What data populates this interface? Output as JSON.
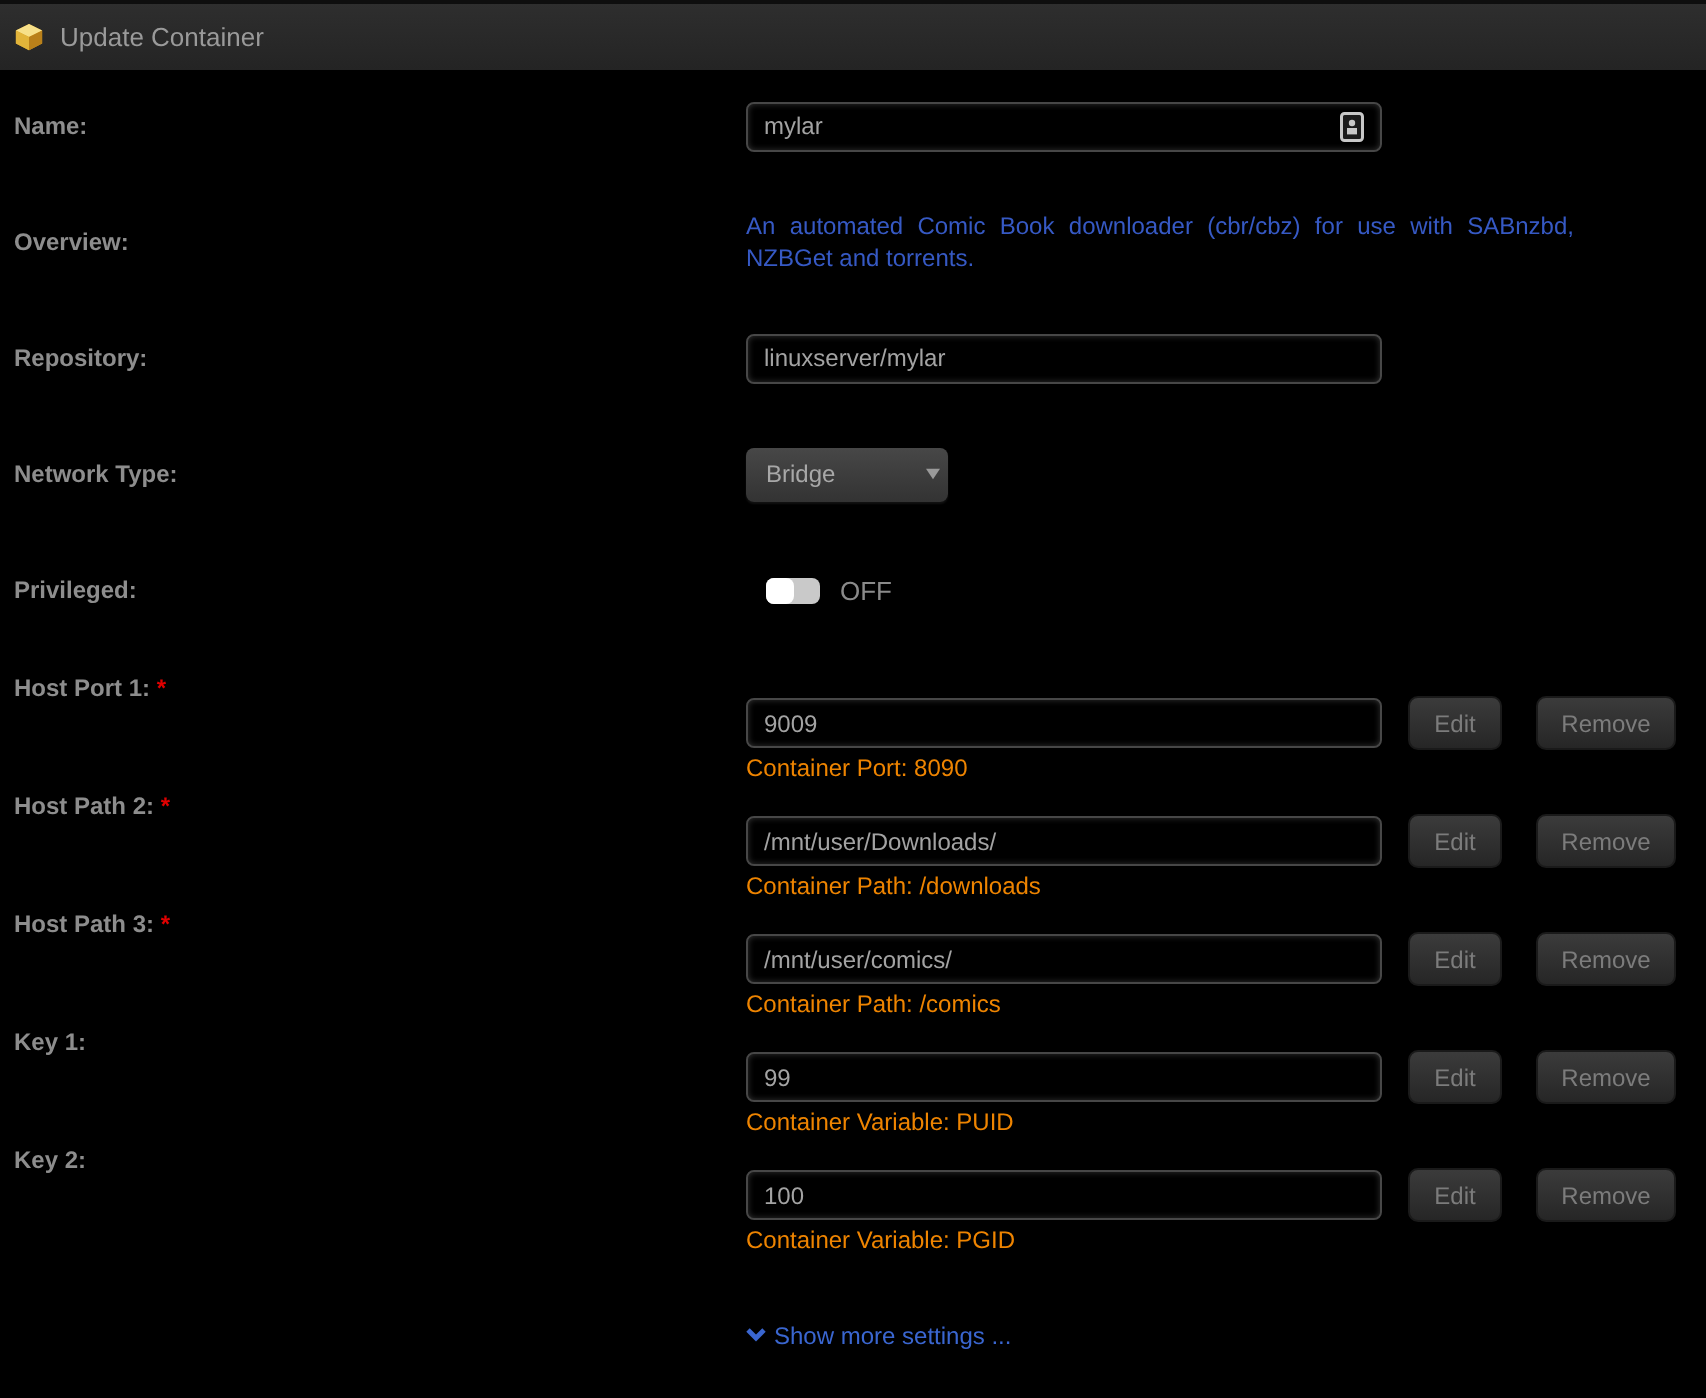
{
  "window": {
    "title": "Update Container"
  },
  "fields": [
    {
      "kind": "input",
      "label": "Name:",
      "value": "mylar",
      "has_icon": true
    },
    {
      "kind": "description",
      "label": "Overview:",
      "text": "An automated Comic Book downloader (cbr/cbz) for use with SABnzbd, NZBGet and torrents."
    },
    {
      "kind": "input",
      "label": "Repository:",
      "value": "linuxserver/mylar",
      "has_icon": false
    },
    {
      "kind": "select",
      "label": "Network Type:",
      "value": "Bridge"
    },
    {
      "kind": "toggle",
      "label": "Privileged:",
      "on": false,
      "state_label": "OFF"
    },
    {
      "kind": "mapping",
      "label": "Host Port 1:",
      "required_mark": "*",
      "value": "9009",
      "hint": "Container Port: 8090",
      "actions": [
        {
          "kind": "edit",
          "label": "Edit"
        },
        {
          "kind": "remove",
          "label": "Remove"
        }
      ]
    },
    {
      "kind": "mapping",
      "label": "Host Path 2:",
      "required_mark": "*",
      "value": "/mnt/user/Downloads/",
      "hint": "Container Path: /downloads",
      "actions": [
        {
          "kind": "edit",
          "label": "Edit"
        },
        {
          "kind": "remove",
          "label": "Remove"
        }
      ]
    },
    {
      "kind": "mapping",
      "label": "Host Path 3:",
      "required_mark": "*",
      "value": "/mnt/user/comics/",
      "hint": "Container Path: /comics",
      "actions": [
        {
          "kind": "edit",
          "label": "Edit"
        },
        {
          "kind": "remove",
          "label": "Remove"
        }
      ]
    },
    {
      "kind": "mapping",
      "label": "Key 1:",
      "value": "99",
      "hint": "Container Variable: PUID",
      "actions": [
        {
          "kind": "edit",
          "label": "Edit"
        },
        {
          "kind": "remove",
          "label": "Remove"
        }
      ]
    },
    {
      "kind": "mapping",
      "label": "Key 2:",
      "value": "100",
      "hint": "Container Variable: PGID",
      "actions": [
        {
          "kind": "edit",
          "label": "Edit"
        },
        {
          "kind": "remove",
          "label": "Remove"
        }
      ]
    }
  ],
  "show_more": {
    "label": "Show more settings ..."
  }
}
